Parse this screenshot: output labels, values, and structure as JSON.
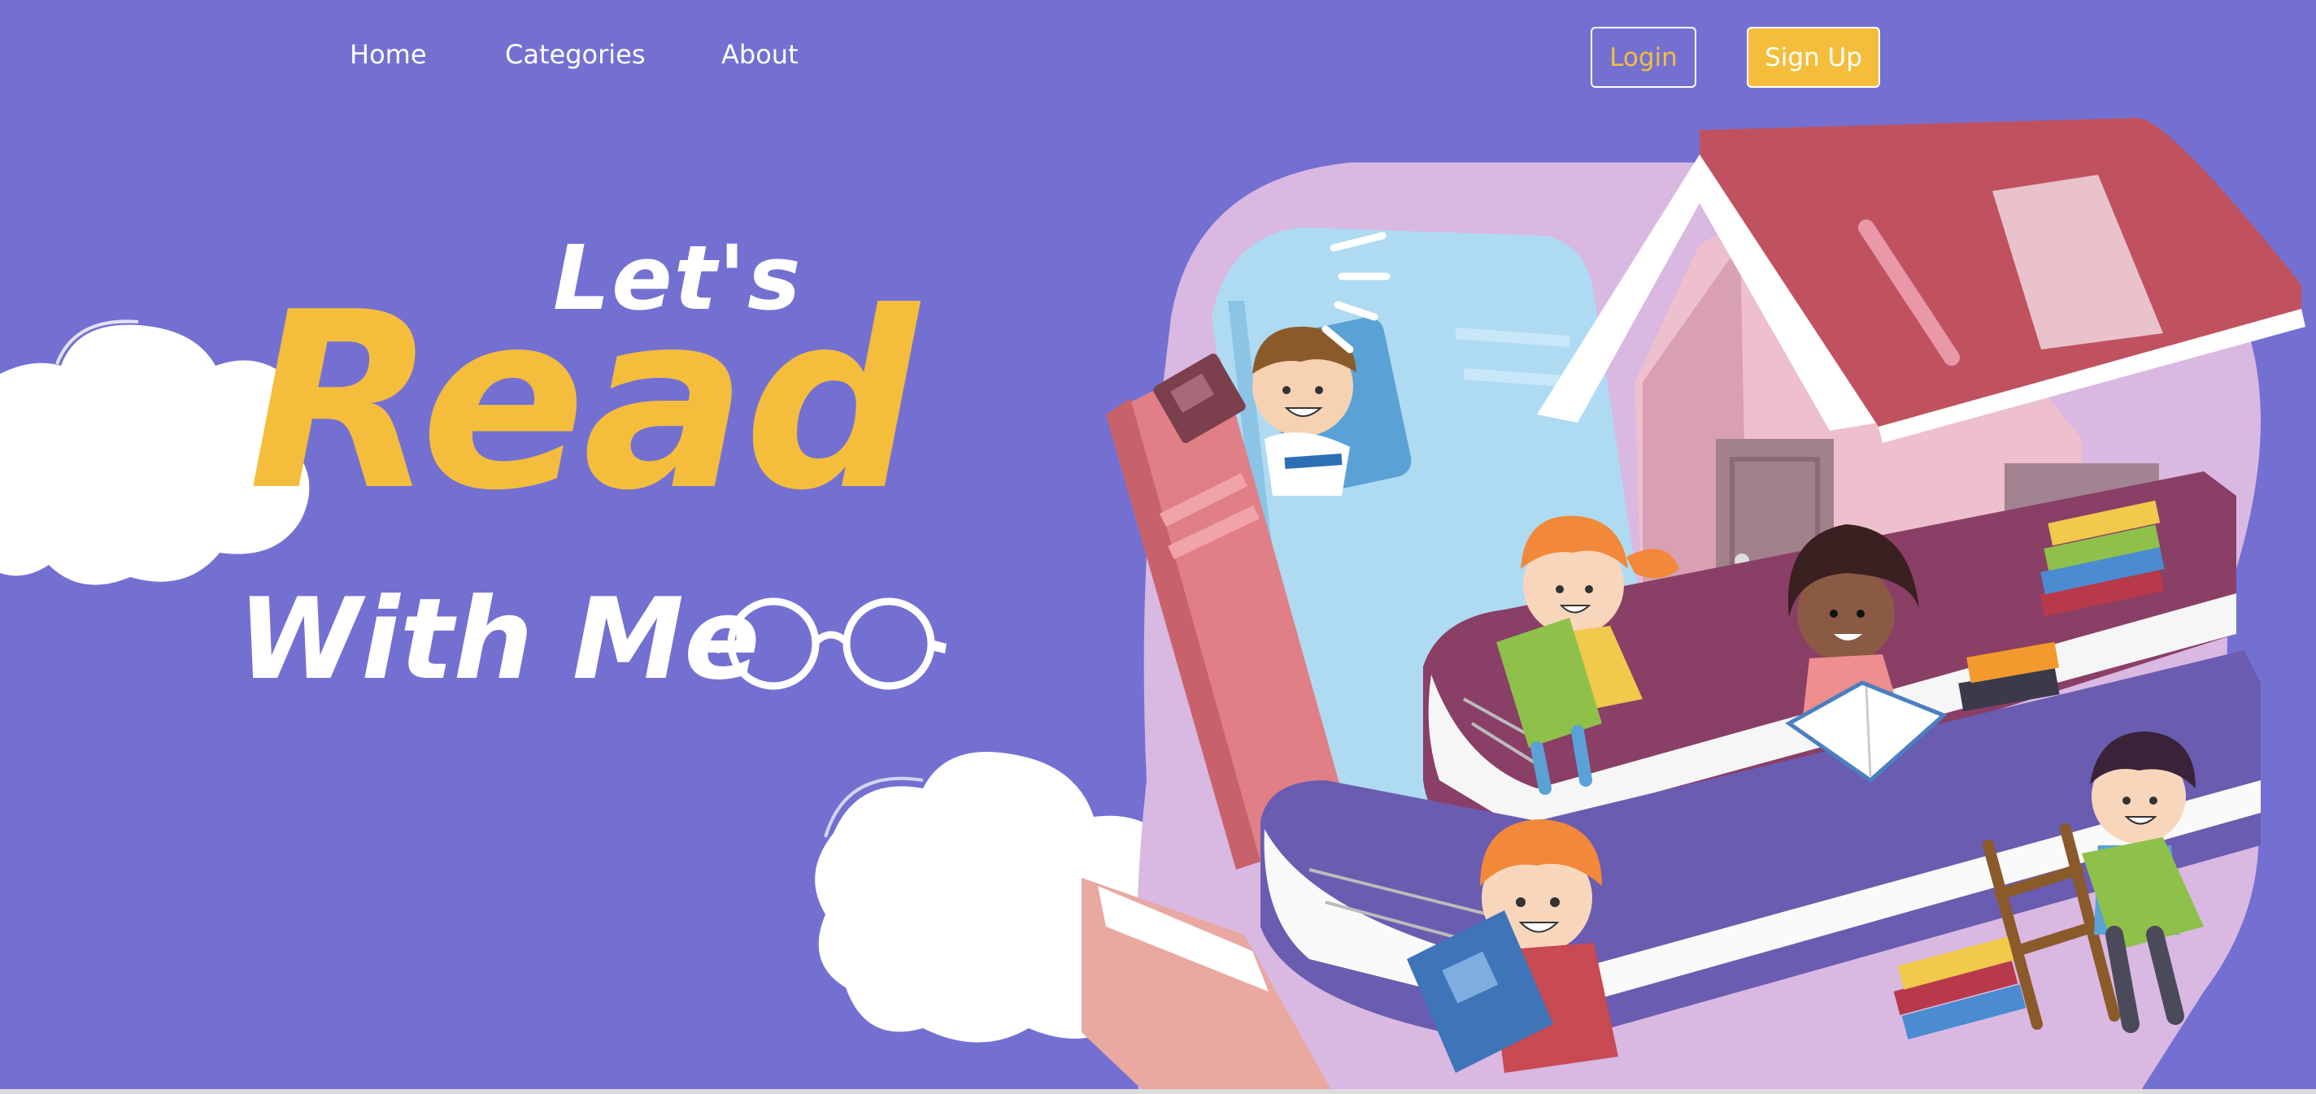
{
  "nav": {
    "links": [
      "Home",
      "Categories",
      "About"
    ],
    "login_label": "Login",
    "signup_label": "Sign Up"
  },
  "hero": {
    "line1": "Let's",
    "line2": "Read",
    "line3": "With Me"
  },
  "colors": {
    "background": "#7470d2",
    "accent_yellow": "#f4be3c",
    "white": "#ffffff"
  },
  "icons": [
    "glasses-icon",
    "cloud",
    "kids-reading-illustration"
  ]
}
